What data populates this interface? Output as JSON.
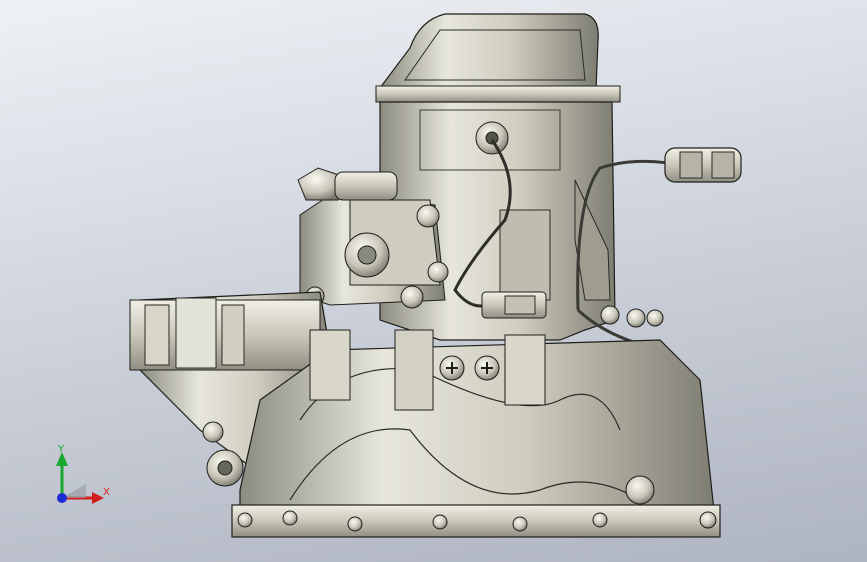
{
  "viewport": {
    "background_top": "#eef1f5",
    "background_bottom": "#aeb4c0"
  },
  "model": {
    "icon": "gearbox-transmission-3d-model",
    "body_color": "#d8d6c9",
    "shadow_color": "#6f6e63",
    "edge_color": "#1e1e1a"
  },
  "triad": {
    "x_label": "X",
    "y_label": "Y",
    "x_color": "#d11f1f",
    "y_color": "#18a82f",
    "z_color": "#1c2bd6"
  }
}
